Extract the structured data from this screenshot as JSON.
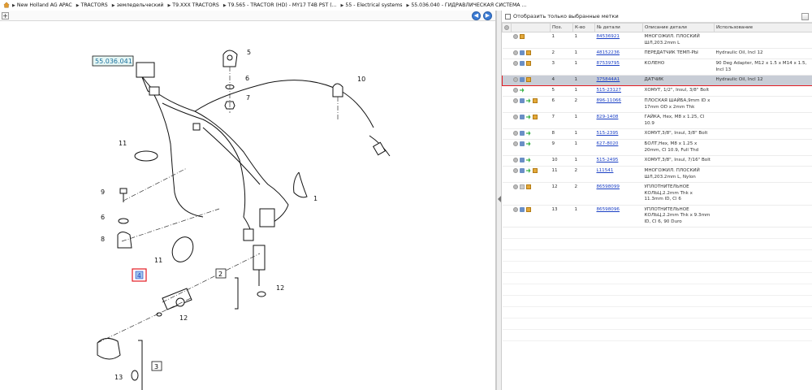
{
  "breadcrumb": [
    "New Holland AG APAC",
    "TRACTORS",
    "земледельческий",
    "T9.XXX TRACTORS",
    "T9.565 - TRACTOR (HD) - MY17 T4B PST (...",
    "55 - Electrical systems",
    "55.036.040 - ГИДРАВЛИЧЕСКАЯ СИСТЕМА ..."
  ],
  "diagram": {
    "ref_label": "55.036.041",
    "callouts": [
      "1",
      "2",
      "3",
      "4",
      "5",
      "6",
      "7",
      "8",
      "9",
      "10",
      "11",
      "12",
      "13"
    ]
  },
  "filter": {
    "label": "Отобразить только выбранные метки"
  },
  "table": {
    "headers": [
      "",
      "",
      "Поз.",
      "К-во",
      "№ детали",
      "Описание детали",
      "Использование"
    ],
    "rows": [
      {
        "pos": "1",
        "qty": "1",
        "part": "84536921",
        "desc": "МНОГОЖИЛ. ПЛОСКИЙ ШЛ,203.2mm L",
        "use": "",
        "icons": [
          "circ",
          "cart"
        ]
      },
      {
        "pos": "2",
        "qty": "1",
        "part": "48152236",
        "desc": "ПЕРЕДАТЧИК ТЕМП-РЫ",
        "use": "Hydraulic Oil, Incl 12",
        "icons": [
          "circ",
          "blue",
          "cart"
        ]
      },
      {
        "pos": "3",
        "qty": "1",
        "part": "87539795",
        "desc": "КОЛЕНО",
        "use": "90 Deg Adapter, M12 x 1.5 x M14 x 1.5, Incl 13",
        "icons": [
          "circ",
          "blue",
          "cart"
        ]
      },
      {
        "pos": "4",
        "qty": "1",
        "part": "375844A1",
        "desc": "ДАТЧИК",
        "use": "Hydraulic Oil, Incl 12",
        "icons": [
          "circ",
          "blue",
          "cart"
        ],
        "selected": true
      },
      {
        "pos": "5",
        "qty": "1",
        "part": "515-23127",
        "desc": "ХОМУТ, 1/2\", Insul, 3/8\" Bolt",
        "use": "",
        "icons": [
          "circ",
          "green"
        ]
      },
      {
        "pos": "6",
        "qty": "2",
        "part": "896-11066",
        "desc": "ПЛОСКАЯ ШАЙБА,9mm ID x 17mm OD x 2mm Thk",
        "use": "",
        "icons": [
          "circ",
          "blue",
          "green",
          "cart"
        ]
      },
      {
        "pos": "7",
        "qty": "1",
        "part": "829-1408",
        "desc": "ГАЙКА, Hex, M8 x 1.25, Cl 10.9",
        "use": "",
        "icons": [
          "circ",
          "blue",
          "green",
          "cart"
        ]
      },
      {
        "pos": "8",
        "qty": "1",
        "part": "515-2395",
        "desc": "ХОМУТ,3/8\", Insul, 3/8\" Bolt",
        "use": "",
        "icons": [
          "circ",
          "blue",
          "green"
        ]
      },
      {
        "pos": "9",
        "qty": "1",
        "part": "627-8020",
        "desc": "БОЛТ,Hex, M8 x 1.25 x 20mm, Cl 10.9, Full Thd",
        "use": "",
        "icons": [
          "circ",
          "blue",
          "green"
        ]
      },
      {
        "pos": "10",
        "qty": "1",
        "part": "515-2495",
        "desc": "ХОМУТ,3/8\", Insul, 7/16\" Bolt",
        "use": "",
        "icons": [
          "circ",
          "blue",
          "green"
        ]
      },
      {
        "pos": "11",
        "qty": "2",
        "part": "L11541",
        "desc": "МНОГОЖИЛ. ПЛОСКИЙ ШЛ,203.2mm L, Nylon",
        "use": "",
        "icons": [
          "circ",
          "blue",
          "green",
          "cart"
        ]
      },
      {
        "pos": "12",
        "qty": "2",
        "part": "86598099",
        "desc": "УПЛОТНИТЕЛЬНОЕ КОЛЬЦ,2.2mm Thk x 11.3mm ID, Cl 6",
        "use": "",
        "icons": [
          "circ",
          "grey",
          "cart"
        ]
      },
      {
        "pos": "13",
        "qty": "1",
        "part": "86598096",
        "desc": "УПЛОТНИТЕЛЬНОЕ КОЛЬЦ,2.2mm Thk x 9.3mm ID, Cl 6, 90 Duro",
        "use": "",
        "icons": [
          "circ",
          "blue",
          "cart"
        ]
      }
    ]
  }
}
